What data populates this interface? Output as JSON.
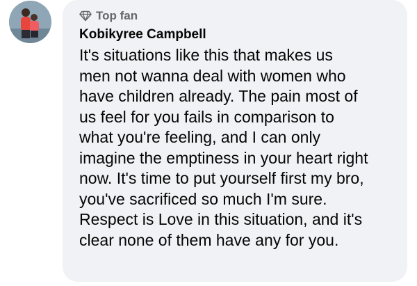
{
  "comment": {
    "badge": {
      "icon": "diamond-icon",
      "label": "Top fan"
    },
    "author": "Kobikyree Campbell",
    "lines": [
      "It's situations like this that makes us",
      "men not wanna deal with women who",
      "have children already. The pain most of",
      "us feel for you fails in comparison to",
      "what you're feeling, and I can only",
      "imagine the emptiness in your heart right",
      "now. It's time to put yourself first my bro,",
      "you've sacrificed so much I'm sure.",
      "Respect is Love in this situation, and it's",
      "clear none of them have any for you."
    ]
  },
  "colors": {
    "bubble": "#f0f2f5",
    "text": "#050505",
    "secondary": "#65676b"
  }
}
